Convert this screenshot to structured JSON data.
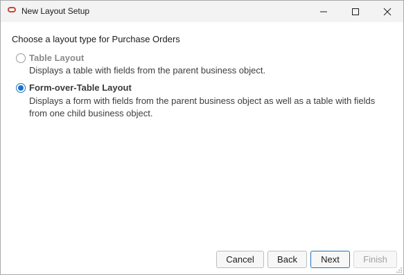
{
  "window": {
    "title": "New Layout Setup",
    "accent_color": "#c74634"
  },
  "content": {
    "prompt": "Choose a layout type for Purchase Orders",
    "options": [
      {
        "label": "Table Layout",
        "description": "Displays a table with fields from the parent business object.",
        "selected": false
      },
      {
        "label": "Form-over-Table Layout",
        "description": "Displays a form with fields from the parent business object as well as a table with fields from one child business object.",
        "selected": true
      }
    ]
  },
  "buttons": {
    "cancel": "Cancel",
    "back": "Back",
    "next": "Next",
    "finish": "Finish"
  },
  "icons": {
    "app": "oracle-logo-icon",
    "minimize": "minimize-icon",
    "maximize": "maximize-icon",
    "close": "close-icon",
    "resize": "resize-grip-icon"
  },
  "colors": {
    "selected_radio": "#1a73c7",
    "disabled_text": "#a0a0a0"
  }
}
